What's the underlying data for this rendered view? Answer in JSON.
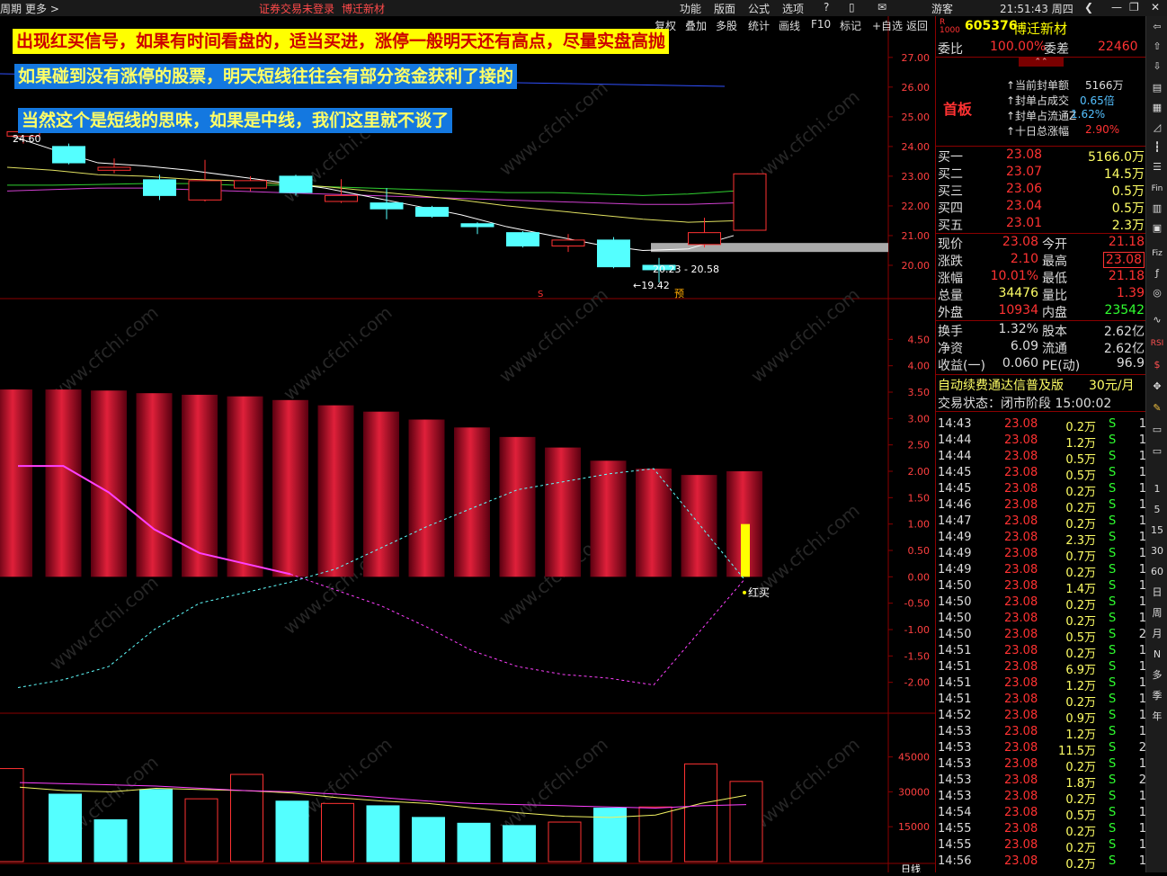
{
  "topbar": {
    "period": "周期",
    "more": "更多 >",
    "login_status": "证券交易未登录",
    "stock_title": "博迁新材",
    "menus": [
      "功能",
      "版面",
      "公式",
      "选项"
    ],
    "user": "游客",
    "clock": "21:51:43 周四"
  },
  "toolbar": [
    "复权",
    "叠加",
    "多股",
    "统计",
    "画线",
    "F10",
    "标记",
    "+自选",
    "返回"
  ],
  "annotations": [
    "出现红买信号，如果有时间看盘的，适当买进，涨停一般明天还有高点，尽量实盘高抛",
    "如果碰到没有涨停的股票，明天短线往往会有部分资金获利了接的",
    "当然这个是短线的思味，如果是中线，我们这里就不谈了"
  ],
  "watermark": "www.cfchi.com",
  "chart_data": [
    {
      "type": "candlestick",
      "yticks": [
        27.0,
        26.0,
        25.0,
        24.0,
        23.0,
        22.0,
        21.0,
        20.0
      ],
      "ylim": [
        19.0,
        27.6
      ],
      "candles": [
        {
          "o": 24.35,
          "c": 24.5,
          "h": 24.7,
          "l": 24.1
        },
        {
          "o": 24.0,
          "c": 23.45,
          "h": 24.1,
          "l": 23.4
        },
        {
          "o": 23.2,
          "c": 23.3,
          "h": 23.6,
          "l": 23.1
        },
        {
          "o": 22.88,
          "c": 22.35,
          "h": 23.05,
          "l": 22.2
        },
        {
          "o": 22.2,
          "c": 22.85,
          "h": 23.55,
          "l": 22.15
        },
        {
          "o": 22.6,
          "c": 22.85,
          "h": 23.0,
          "l": 22.5
        },
        {
          "o": 23.0,
          "c": 22.45,
          "h": 23.05,
          "l": 22.35
        },
        {
          "o": 22.15,
          "c": 22.35,
          "h": 22.9,
          "l": 22.1
        },
        {
          "o": 22.1,
          "c": 21.9,
          "h": 22.6,
          "l": 21.55
        },
        {
          "o": 21.95,
          "c": 21.65,
          "h": 22.0,
          "l": 21.6
        },
        {
          "o": 21.4,
          "c": 21.3,
          "h": 21.45,
          "l": 21.05
        },
        {
          "o": 21.1,
          "c": 20.65,
          "h": 21.15,
          "l": 20.6
        },
        {
          "o": 20.65,
          "c": 20.85,
          "h": 21.05,
          "l": 20.45
        },
        {
          "o": 20.85,
          "c": 19.95,
          "h": 20.95,
          "l": 19.9
        },
        {
          "o": 20.0,
          "c": 19.85,
          "h": 20.25,
          "l": 19.42
        },
        {
          "o": 20.7,
          "c": 21.1,
          "h": 21.6,
          "l": 20.6
        },
        {
          "o": 21.18,
          "c": 23.08,
          "h": 23.08,
          "l": 21.18
        }
      ],
      "ma_white": [
        24.4,
        23.9,
        23.45,
        23.35,
        23.2,
        23.0,
        22.8,
        22.6,
        22.3,
        22.0,
        21.7,
        21.3,
        21.0,
        20.7,
        20.5,
        20.55,
        21.0
      ],
      "ma_yellow": [
        23.3,
        23.2,
        23.05,
        23.0,
        22.9,
        22.85,
        22.75,
        22.65,
        22.5,
        22.35,
        22.2,
        22.0,
        21.85,
        21.7,
        21.55,
        21.45,
        21.5
      ],
      "ma_green": [
        22.7,
        22.7,
        22.72,
        22.75,
        22.75,
        22.7,
        22.7,
        22.65,
        22.6,
        22.55,
        22.5,
        22.45,
        22.45,
        22.4,
        22.35,
        22.4,
        22.5
      ],
      "ma_purple": [
        22.5,
        22.55,
        22.6,
        22.6,
        22.55,
        22.5,
        22.45,
        22.4,
        22.35,
        22.3,
        22.25,
        22.2,
        22.15,
        22.1,
        22.05,
        22.05,
        22.1
      ],
      "label_high": "24.60",
      "label_range": "20.23 - 20.58",
      "label_low": "19.42",
      "marker_s": "S",
      "marker_yu": "预"
    },
    {
      "type": "bar",
      "yticks": [
        4.5,
        4.0,
        3.5,
        3.0,
        2.5,
        2.0,
        1.5,
        1.0,
        0.5,
        0.0,
        -0.5,
        -1.0,
        -1.5,
        -2.0
      ],
      "ylim": [
        -2.5,
        5.0
      ],
      "bars": [
        3.55,
        3.55,
        3.53,
        3.48,
        3.45,
        3.42,
        3.35,
        3.25,
        3.13,
        2.98,
        2.83,
        2.65,
        2.45,
        2.2,
        2.05,
        1.93,
        2.0
      ],
      "yellow_bar": 1.0,
      "magenta": [
        2.1,
        2.1,
        1.6,
        0.9,
        0.45,
        0.25,
        0.05,
        -0.25,
        -0.55,
        -0.95,
        -1.4,
        -1.7,
        -1.85,
        -1.92,
        -2.05,
        -1.05,
        -0.05
      ],
      "cyan": [
        -2.1,
        -1.95,
        -1.7,
        -1.0,
        -0.5,
        -0.3,
        -0.1,
        0.15,
        0.55,
        0.95,
        1.3,
        1.65,
        1.8,
        1.95,
        2.05,
        1.0,
        -0.05
      ],
      "signal_label": "红买"
    },
    {
      "type": "bar",
      "yticks": [
        45000,
        30000,
        15000
      ],
      "ylim": [
        0,
        58000
      ],
      "volumes": [
        40000,
        29000,
        18000,
        31000,
        27000,
        37500,
        26000,
        25000,
        24000,
        19000,
        16500,
        15500,
        17000,
        23000,
        23500,
        42000,
        34476
      ],
      "colors": [
        "red",
        "cyan",
        "cyan",
        "cyan",
        "red",
        "red",
        "cyan",
        "red",
        "cyan",
        "cyan",
        "cyan",
        "cyan",
        "red",
        "cyan",
        "red",
        "red",
        "red"
      ],
      "ma1": [
        32000,
        30500,
        30000,
        31500,
        31000,
        30500,
        29500,
        27500,
        26000,
        25000,
        23000,
        21000,
        19500,
        19000,
        20000,
        25000,
        28500
      ],
      "ma2": [
        34000,
        33500,
        33000,
        32500,
        31500,
        30500,
        30000,
        29000,
        27500,
        26000,
        25000,
        24500,
        24000,
        23500,
        23000,
        24000,
        24500
      ],
      "bottom_label": "日线"
    }
  ],
  "quote": {
    "code": "605376",
    "name": "博迁新材",
    "weibi_label": "委比",
    "weibi": "100.00%",
    "weicha_label": "委差",
    "weicha": "22460",
    "board": "首板",
    "seal_lines": [
      {
        "label": "当前封单额",
        "value": "5166万"
      },
      {
        "label": "封单占成交",
        "value": "0.65倍"
      },
      {
        "label": "封单占流通Z",
        "value": "1.62%"
      },
      {
        "label": "十日总涨幅",
        "value": "2.90%"
      }
    ],
    "bids": [
      {
        "label": "买一",
        "price": "23.08",
        "vol": "5166.0万"
      },
      {
        "label": "买二",
        "price": "23.07",
        "vol": "14.5万"
      },
      {
        "label": "买三",
        "price": "23.06",
        "vol": "0.5万"
      },
      {
        "label": "买四",
        "price": "23.04",
        "vol": "0.5万"
      },
      {
        "label": "买五",
        "price": "23.01",
        "vol": "2.3万"
      }
    ],
    "stats": [
      {
        "l1": "现价",
        "v1": "23.08",
        "l2": "今开",
        "v2": "21.18"
      },
      {
        "l1": "涨跌",
        "v1": "2.10",
        "l2": "最高",
        "v2": "23.08"
      },
      {
        "l1": "涨幅",
        "v1": "10.01%",
        "l2": "最低",
        "v2": "21.18"
      },
      {
        "l1": "总量",
        "v1": "34476",
        "l2": "量比",
        "v2": "1.39"
      },
      {
        "l1": "外盘",
        "v1": "10934",
        "l2": "内盘",
        "v2": "23542"
      }
    ],
    "fin": [
      {
        "l1": "换手",
        "v1": "1.32%",
        "l2": "股本",
        "v2": "2.62亿"
      },
      {
        "l1": "净资",
        "v1": "6.09",
        "l2": "流通",
        "v2": "2.62亿"
      },
      {
        "l1": "收益(一)",
        "v1": "0.060",
        "l2": "PE(动)",
        "v2": "96.9"
      }
    ],
    "ad": "自动续费通达信普及版",
    "ad_price": "30元/月",
    "trade_status": "交易状态：闭市阶段 15:00:02",
    "ticks": [
      [
        "14:43",
        "23.08",
        "0.2万",
        "S",
        "1"
      ],
      [
        "14:44",
        "23.08",
        "1.2万",
        "S",
        "1"
      ],
      [
        "14:44",
        "23.08",
        "0.5万",
        "S",
        "1"
      ],
      [
        "14:45",
        "23.08",
        "0.5万",
        "S",
        "1"
      ],
      [
        "14:45",
        "23.08",
        "0.2万",
        "S",
        "1"
      ],
      [
        "14:46",
        "23.08",
        "0.2万",
        "S",
        "1"
      ],
      [
        "14:47",
        "23.08",
        "0.2万",
        "S",
        "1"
      ],
      [
        "14:49",
        "23.08",
        "2.3万",
        "S",
        "1"
      ],
      [
        "14:49",
        "23.08",
        "0.7万",
        "S",
        "1"
      ],
      [
        "14:49",
        "23.08",
        "0.2万",
        "S",
        "1"
      ],
      [
        "14:50",
        "23.08",
        "1.4万",
        "S",
        "1"
      ],
      [
        "14:50",
        "23.08",
        "0.2万",
        "S",
        "1"
      ],
      [
        "14:50",
        "23.08",
        "0.2万",
        "S",
        "1"
      ],
      [
        "14:50",
        "23.08",
        "0.5万",
        "S",
        "2"
      ],
      [
        "14:51",
        "23.08",
        "0.2万",
        "S",
        "1"
      ],
      [
        "14:51",
        "23.08",
        "6.9万",
        "S",
        "1"
      ],
      [
        "14:51",
        "23.08",
        "1.2万",
        "S",
        "1"
      ],
      [
        "14:51",
        "23.08",
        "0.2万",
        "S",
        "1"
      ],
      [
        "14:52",
        "23.08",
        "0.9万",
        "S",
        "1"
      ],
      [
        "14:53",
        "23.08",
        "1.2万",
        "S",
        "1"
      ],
      [
        "14:53",
        "23.08",
        "11.5万",
        "S",
        "2"
      ],
      [
        "14:53",
        "23.08",
        "0.2万",
        "S",
        "1"
      ],
      [
        "14:53",
        "23.08",
        "1.8万",
        "S",
        "2"
      ],
      [
        "14:53",
        "23.08",
        "0.2万",
        "S",
        "1"
      ],
      [
        "14:54",
        "23.08",
        "0.5万",
        "S",
        "1"
      ],
      [
        "14:55",
        "23.08",
        "0.2万",
        "S",
        "1"
      ],
      [
        "14:55",
        "23.08",
        "0.2万",
        "S",
        "1"
      ],
      [
        "14:56",
        "23.08",
        "0.2万",
        "S",
        "1"
      ]
    ]
  },
  "side_tools": [
    "1",
    "5",
    "15",
    "30",
    "60",
    "日",
    "周",
    "月",
    "N",
    "多",
    "季",
    "年"
  ],
  "colors": {
    "up": "#ff3232",
    "down": "#54ffff",
    "panel_border": "#8b0000",
    "yellow": "#ffff00"
  }
}
